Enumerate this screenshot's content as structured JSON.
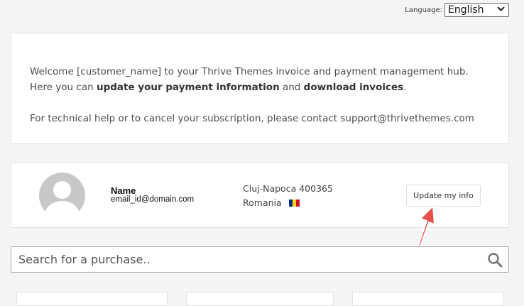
{
  "language": {
    "label": "Language:",
    "selected": "English"
  },
  "welcome": {
    "line1": "Welcome [customer_name] to your Thrive Themes invoice and payment management hub.",
    "line2_prefix": "Here you can ",
    "line2_bold1": "update your payment information",
    "line2_mid": " and ",
    "line2_bold2": "download invoices",
    "line2_suffix": ".",
    "line3": "For technical help or to cancel your subscription, please contact support@thrivethemes.com"
  },
  "profile": {
    "name": "Name",
    "email": "email_id@domain.com",
    "city_line": "Cluj-Napoca 400365",
    "country": "Romania",
    "update_button": "Update my info"
  },
  "search": {
    "placeholder": "Search for a purchase.."
  },
  "colors": {
    "arrow": "#e8504a",
    "flag": [
      "#002b7f",
      "#fcd116",
      "#ce1126"
    ]
  }
}
